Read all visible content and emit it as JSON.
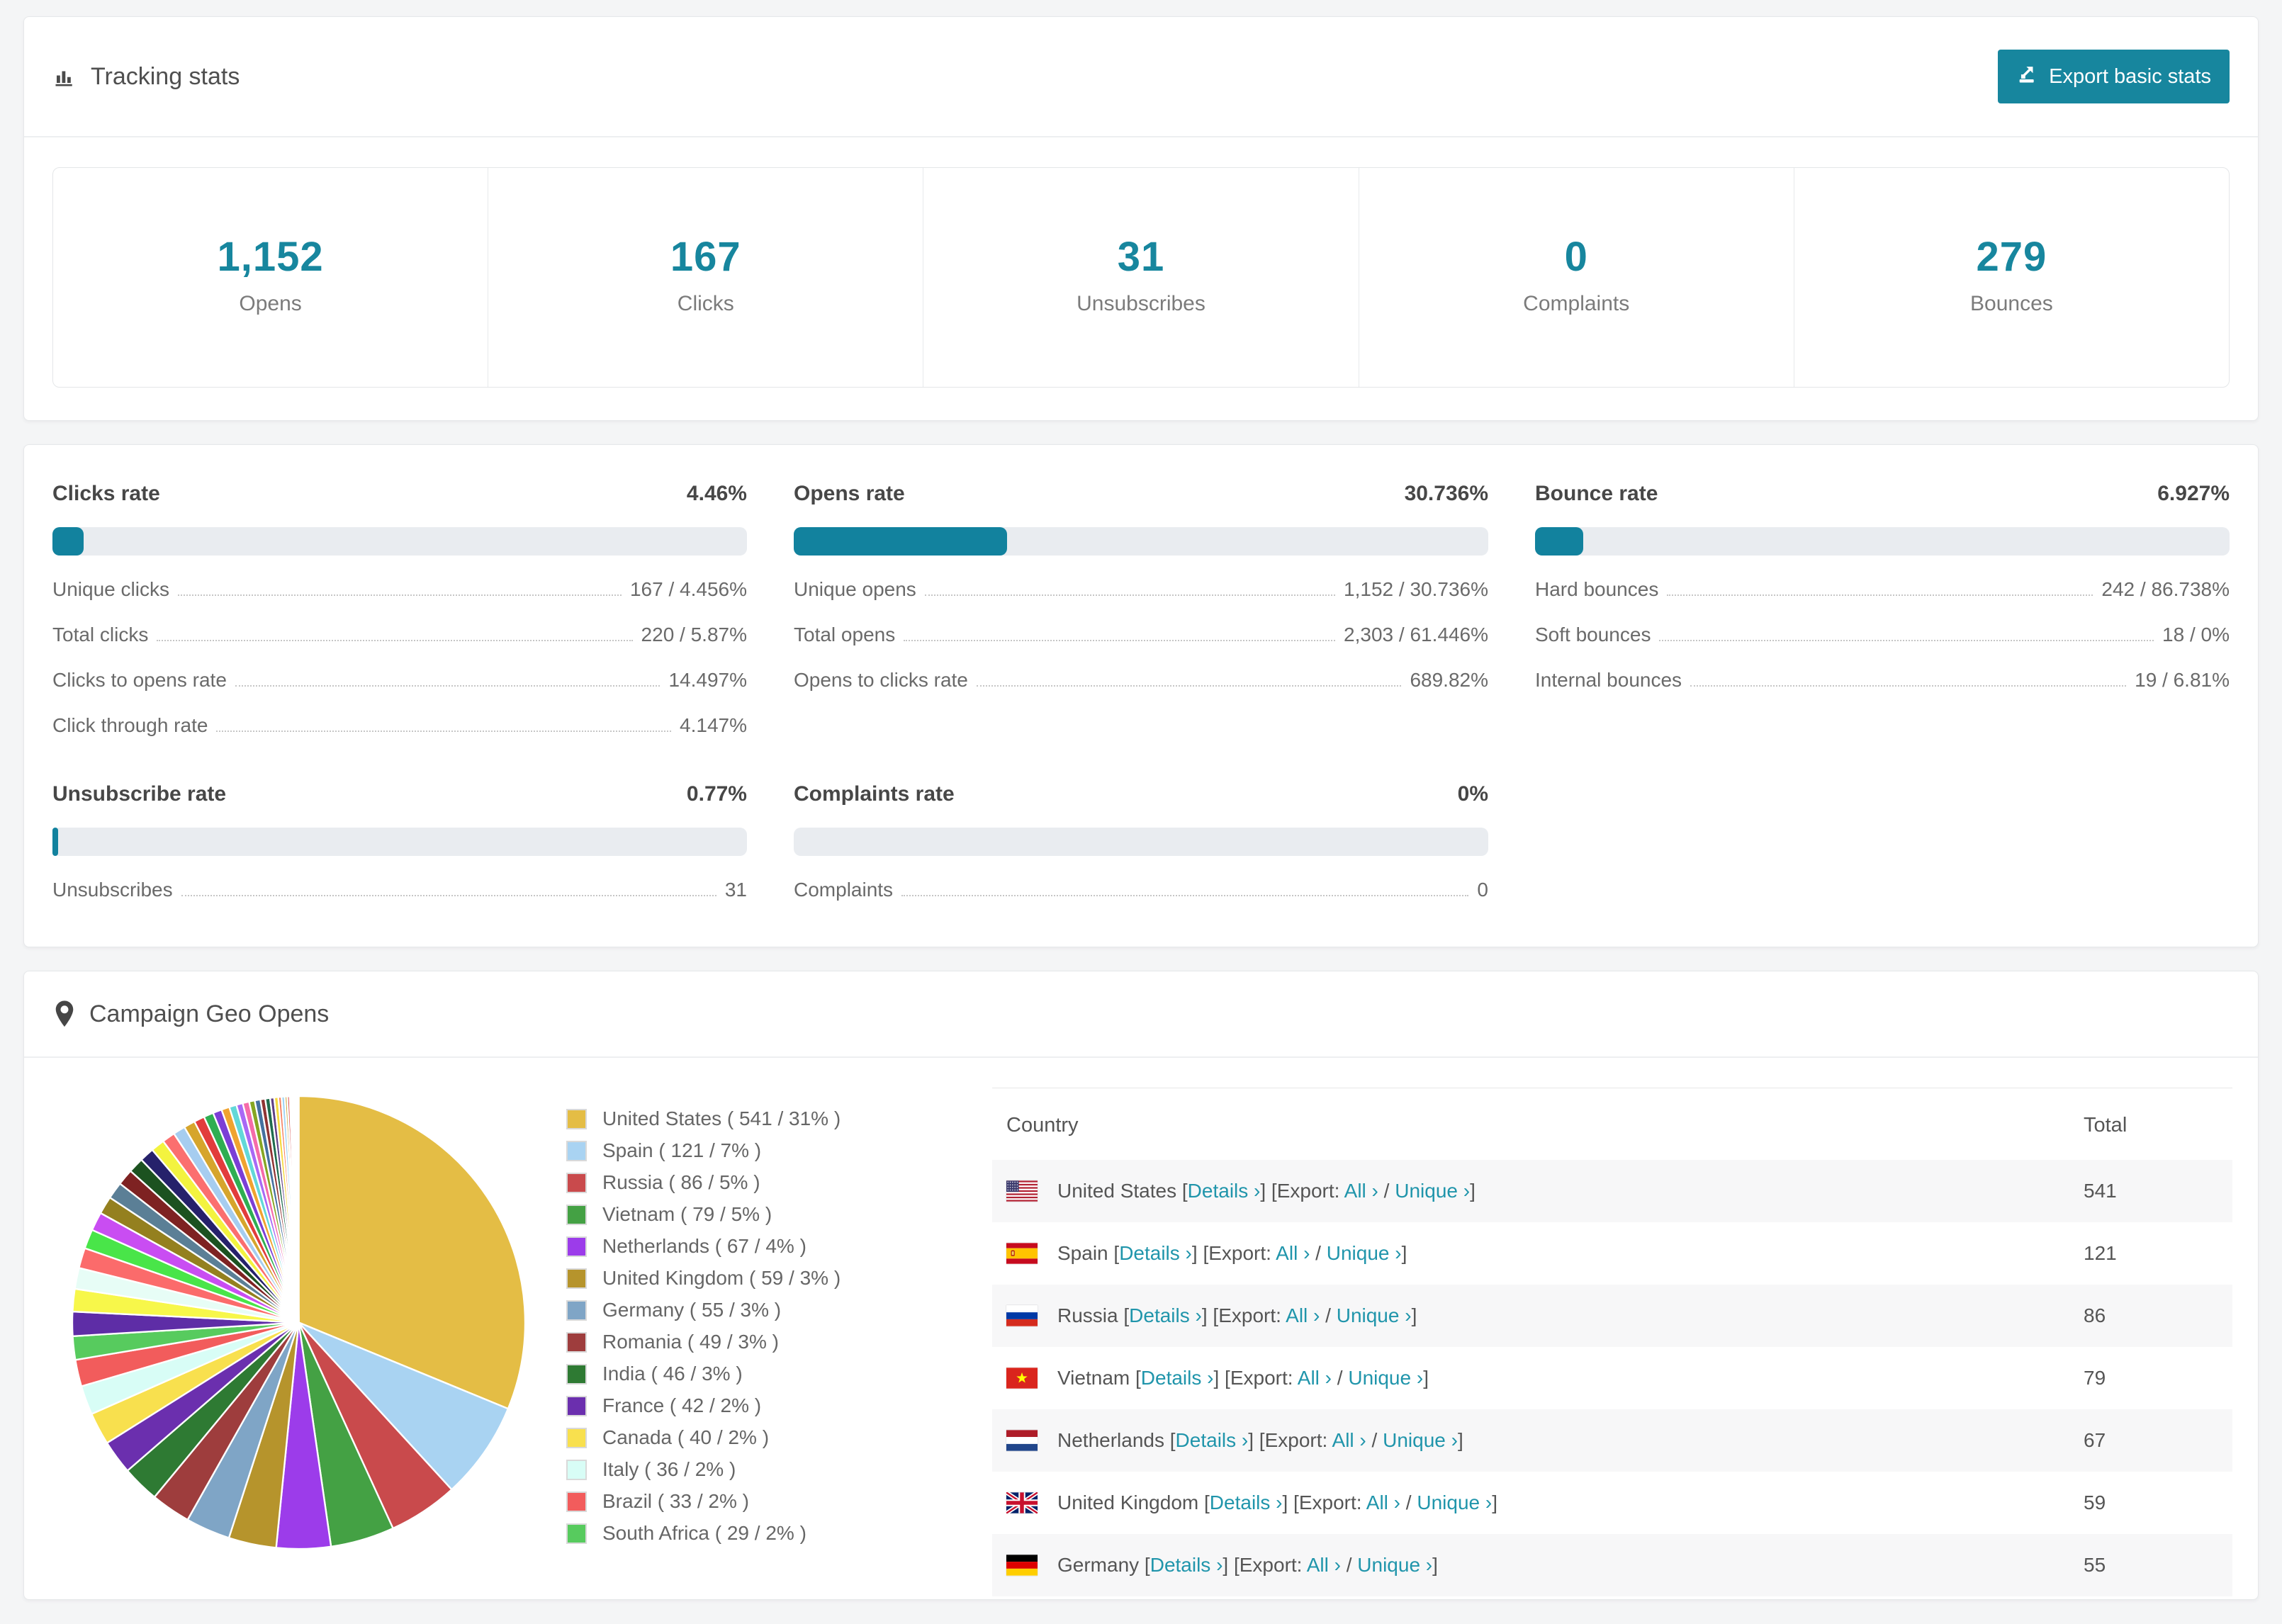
{
  "accent": "#17869e",
  "tracking": {
    "title": "Tracking stats",
    "export_button": "Export basic stats",
    "stats": [
      {
        "value": "1,152",
        "label": "Opens"
      },
      {
        "value": "167",
        "label": "Clicks"
      },
      {
        "value": "31",
        "label": "Unsubscribes"
      },
      {
        "value": "0",
        "label": "Complaints"
      },
      {
        "value": "279",
        "label": "Bounces"
      }
    ]
  },
  "rates": [
    {
      "title": "Clicks rate",
      "pct_label": "4.46%",
      "pct": 4.46,
      "rows": [
        {
          "label": "Unique clicks",
          "value": "167 / 4.456%"
        },
        {
          "label": "Total clicks",
          "value": "220 / 5.87%"
        },
        {
          "label": "Clicks to opens rate",
          "value": "14.497%"
        },
        {
          "label": "Click through rate",
          "value": "4.147%"
        }
      ]
    },
    {
      "title": "Opens rate",
      "pct_label": "30.736%",
      "pct": 30.736,
      "rows": [
        {
          "label": "Unique opens",
          "value": "1,152 / 30.736%"
        },
        {
          "label": "Total opens",
          "value": "2,303 / 61.446%"
        },
        {
          "label": "Opens to clicks rate",
          "value": "689.82%"
        }
      ]
    },
    {
      "title": "Bounce rate",
      "pct_label": "6.927%",
      "pct": 6.927,
      "rows": [
        {
          "label": "Hard bounces",
          "value": "242 / 86.738%"
        },
        {
          "label": "Soft bounces",
          "value": "18 / 0%"
        },
        {
          "label": "Internal bounces",
          "value": "19 / 6.81%"
        }
      ]
    },
    {
      "title": "Unsubscribe rate",
      "pct_label": "0.77%",
      "pct": 0.77,
      "rows": [
        {
          "label": "Unsubscribes",
          "value": "31"
        }
      ]
    },
    {
      "title": "Complaints rate",
      "pct_label": "0%",
      "pct": 0,
      "rows": [
        {
          "label": "Complaints",
          "value": "0"
        }
      ]
    }
  ],
  "geo": {
    "title": "Campaign Geo Opens",
    "chart_data": {
      "type": "pie",
      "title": "Campaign Geo Opens",
      "legend_position": "right",
      "series": [
        {
          "name": "United States",
          "count": 541,
          "pct": "31",
          "color": "#e4bd45",
          "flag": "us"
        },
        {
          "name": "Spain",
          "count": 121,
          "pct": "7",
          "color": "#a9d3f2",
          "flag": "es"
        },
        {
          "name": "Russia",
          "count": 86,
          "pct": "5",
          "color": "#c94a4c",
          "flag": "ru"
        },
        {
          "name": "Vietnam",
          "count": 79,
          "pct": "5",
          "color": "#44a144",
          "flag": "vn"
        },
        {
          "name": "Netherlands",
          "count": 67,
          "pct": "4",
          "color": "#9c3cea",
          "flag": "nl"
        },
        {
          "name": "United Kingdom",
          "count": 59,
          "pct": "3",
          "color": "#b6942c",
          "flag": "gb"
        },
        {
          "name": "Germany",
          "count": 55,
          "pct": "3",
          "color": "#7fa5c6",
          "flag": "de"
        },
        {
          "name": "Romania",
          "count": 49,
          "pct": "3",
          "color": "#9e3d3d",
          "flag": "ro"
        },
        {
          "name": "India",
          "count": 46,
          "pct": "3",
          "color": "#2e7a33",
          "flag": "in"
        },
        {
          "name": "France",
          "count": 42,
          "pct": "2",
          "color": "#6b2fae",
          "flag": "fr"
        },
        {
          "name": "Canada",
          "count": 40,
          "pct": "2",
          "color": "#f8e04e",
          "flag": "ca"
        },
        {
          "name": "Italy",
          "count": 36,
          "pct": "2",
          "color": "#d8fdf6",
          "flag": "it"
        },
        {
          "name": "Brazil",
          "count": 33,
          "pct": "2",
          "color": "#f25c5c",
          "flag": "br"
        },
        {
          "name": "South Africa",
          "count": 29,
          "pct": "2",
          "color": "#57cb5e",
          "flag": "za"
        }
      ],
      "other_slices": [
        {
          "count": 30,
          "color": "#5e2da6"
        },
        {
          "count": 28,
          "color": "#f7f74a"
        },
        {
          "count": 26,
          "color": "#e7fdf6"
        },
        {
          "count": 25,
          "color": "#fb6b6b"
        },
        {
          "count": 24,
          "color": "#49e549"
        },
        {
          "count": 23,
          "color": "#c94df2"
        },
        {
          "count": 22,
          "color": "#94801f"
        },
        {
          "count": 21,
          "color": "#5b7f96"
        },
        {
          "count": 20,
          "color": "#7e2222"
        },
        {
          "count": 19,
          "color": "#1c5220"
        },
        {
          "count": 18,
          "color": "#26216b"
        },
        {
          "count": 17,
          "color": "#f3f33f"
        },
        {
          "count": 16,
          "color": "#fb6f6f"
        },
        {
          "count": 15,
          "color": "#a6cdf0"
        },
        {
          "count": 14,
          "color": "#d6a52c"
        },
        {
          "count": 13,
          "color": "#e23c3c"
        },
        {
          "count": 12,
          "color": "#2fae52"
        },
        {
          "count": 11,
          "color": "#7b3ed6"
        },
        {
          "count": 10,
          "color": "#f0a32f"
        },
        {
          "count": 9,
          "color": "#62d8d8"
        },
        {
          "count": 8,
          "color": "#a869f5"
        },
        {
          "count": 8,
          "color": "#f56ba9"
        },
        {
          "count": 7,
          "color": "#86a622"
        },
        {
          "count": 7,
          "color": "#44719f"
        },
        {
          "count": 6,
          "color": "#8f3333"
        },
        {
          "count": 6,
          "color": "#1f6b4d"
        },
        {
          "count": 5,
          "color": "#5f3f85"
        },
        {
          "count": 5,
          "color": "#f5d93f"
        },
        {
          "count": 4,
          "color": "#f57f5f"
        },
        {
          "count": 4,
          "color": "#9fd4f5"
        },
        {
          "count": 3,
          "color": "#c9a22f"
        },
        {
          "count": 3,
          "color": "#d64444"
        },
        {
          "count": 2,
          "color": "#3f9f3f"
        },
        {
          "count": 2,
          "color": "#8f54e0"
        },
        {
          "count": 2,
          "color": "#f5c13f"
        },
        {
          "count": 1,
          "color": "#6bd8b0"
        },
        {
          "count": 1,
          "color": "#c959e8"
        },
        {
          "count": 1,
          "color": "#f59f9f"
        },
        {
          "count": 1,
          "color": "#6b8fb0"
        },
        {
          "count": 1,
          "color": "#b0b03f"
        }
      ]
    },
    "table": {
      "headers": [
        "Country",
        "Total"
      ],
      "labels": {
        "details": "Details ›",
        "export": "Export:",
        "all": "All ›",
        "unique": "Unique ›"
      },
      "rows": [
        {
          "country": "United States",
          "flag": "us",
          "total": "541"
        },
        {
          "country": "Spain",
          "flag": "es",
          "total": "121"
        },
        {
          "country": "Russia",
          "flag": "ru",
          "total": "86"
        },
        {
          "country": "Vietnam",
          "flag": "vn",
          "total": "79"
        },
        {
          "country": "Netherlands",
          "flag": "nl",
          "total": "67"
        },
        {
          "country": "United Kingdom",
          "flag": "gb",
          "total": "59"
        },
        {
          "country": "Germany",
          "flag": "de",
          "total": "55"
        }
      ]
    }
  }
}
